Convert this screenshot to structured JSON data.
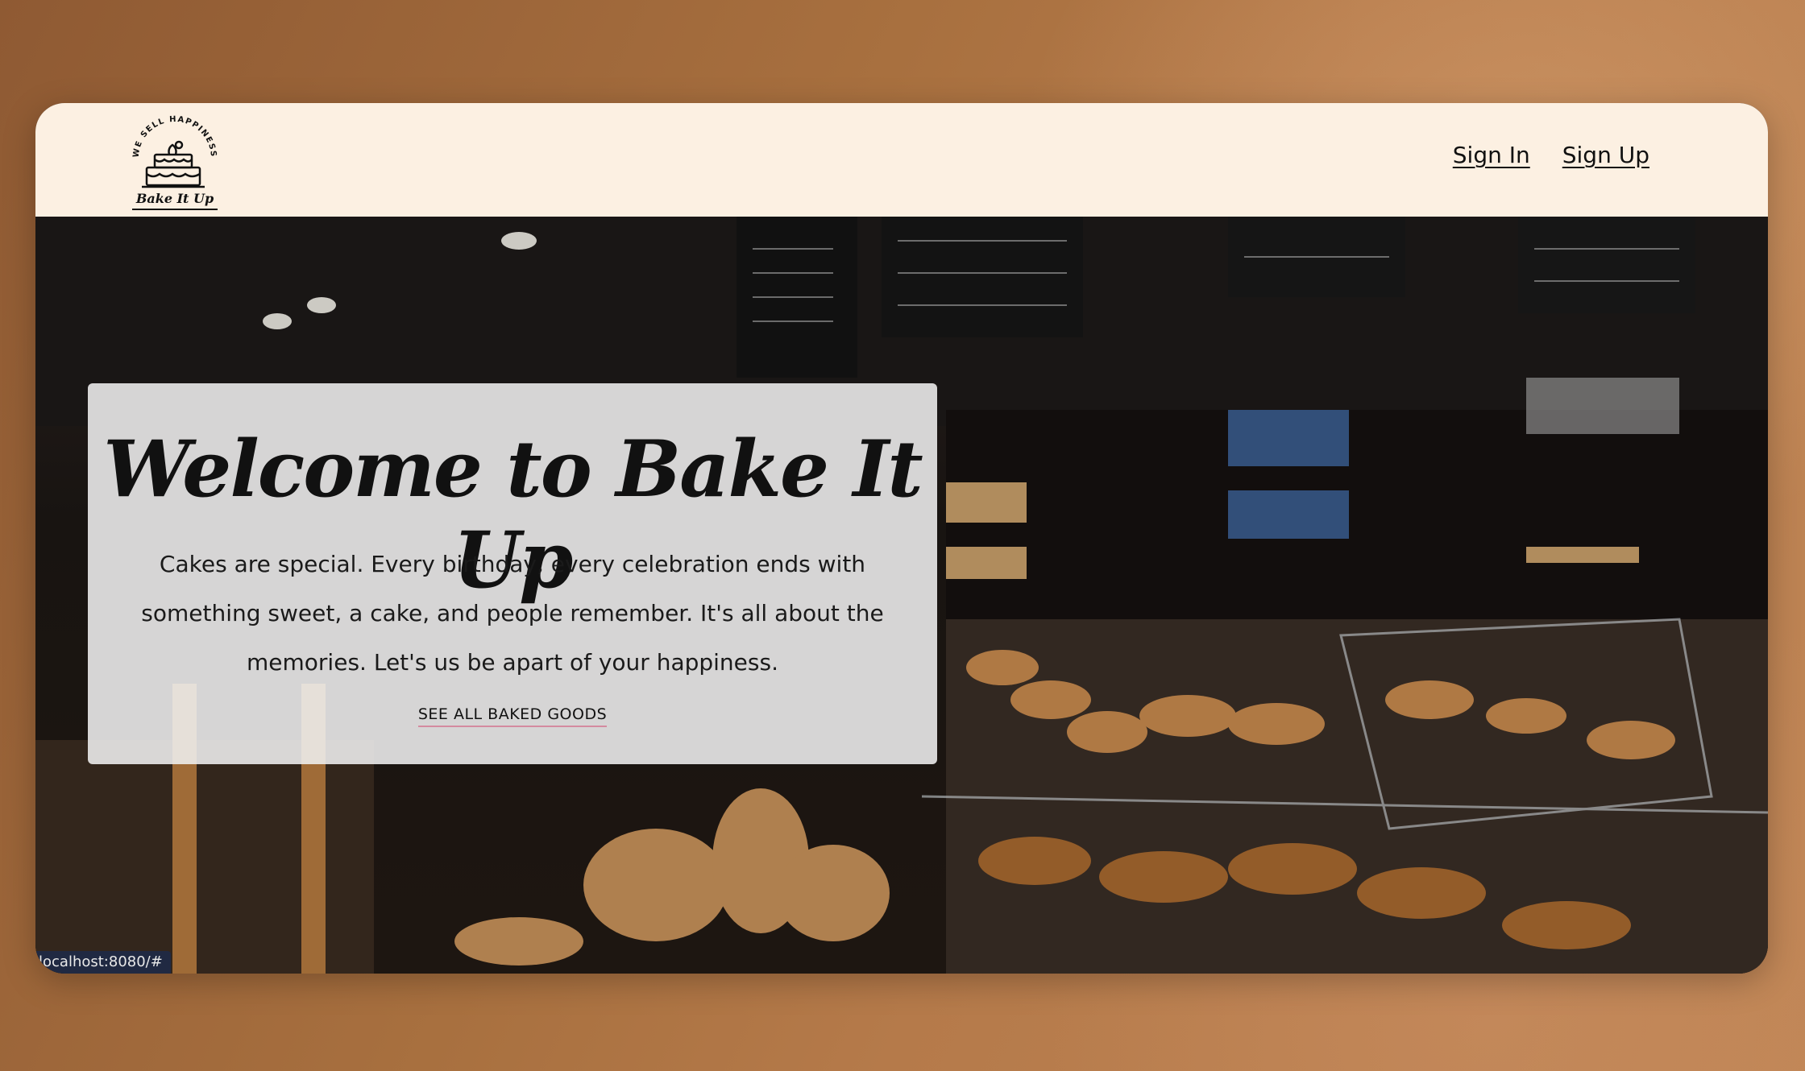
{
  "logo": {
    "arc_text": "WE SELL HAPPINESS",
    "brand": "Bake It Up"
  },
  "nav": {
    "sign_in": "Sign In",
    "sign_up": "Sign Up"
  },
  "hero": {
    "title": "Welcome to Bake It Up",
    "description": "Cakes are special. Every birthday, every celebration ends with something sweet, a cake, and people remember. It's all about the memories. Let's us be apart of your happiness.",
    "cta": "SEE ALL BAKED GOODS"
  },
  "status_bar": {
    "url": "localhost:8080/#"
  },
  "colors": {
    "navbar_bg": "#fcf0e2",
    "page_bg": "#a56a3e",
    "card_bg": "rgba(240,240,240,0.88)",
    "status_bg": "#202942"
  }
}
